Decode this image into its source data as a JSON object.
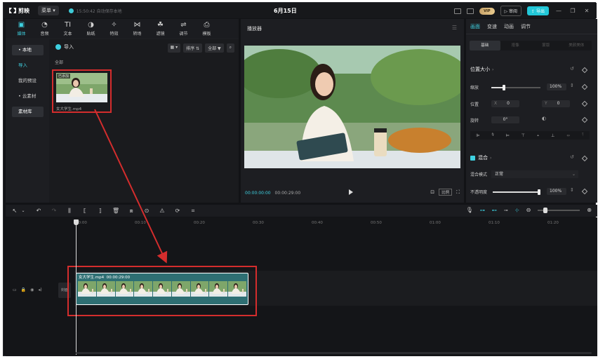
{
  "topbar": {
    "app_name": "剪映",
    "menu_label": "菜单",
    "autosave": "15:50:42 自动保存本地",
    "title": "6月15日",
    "vip_label": "VIP",
    "review_label": "审阅",
    "export_label": "导出"
  },
  "tools": [
    {
      "icon": "media-icon",
      "label": "媒体"
    },
    {
      "icon": "audio-icon",
      "label": "音频"
    },
    {
      "icon": "text-icon",
      "label": "文本"
    },
    {
      "icon": "sticker-icon",
      "label": "贴纸"
    },
    {
      "icon": "effects-icon",
      "label": "特效"
    },
    {
      "icon": "transition-icon",
      "label": "转场"
    },
    {
      "icon": "filter-icon",
      "label": "滤镜"
    },
    {
      "icon": "adjust-icon",
      "label": "调节"
    },
    {
      "icon": "template-icon",
      "label": "模板"
    }
  ],
  "side_nav": {
    "local": "• 本地",
    "import": "导入",
    "my_presets": "我的预设",
    "cloud": "• 云素材",
    "library": "素材库"
  },
  "media": {
    "import_label": "导入",
    "sort_label": "排序",
    "filter_label": "全部",
    "all_label": "全部",
    "added_badge": "已添加",
    "file_name": "女大学生.mp4"
  },
  "player": {
    "title": "播放器",
    "current_time": "00:00:00:00",
    "total_time": "00:00:29:00",
    "ratio_label": "比例"
  },
  "properties": {
    "tabs": [
      "画面",
      "变速",
      "动画",
      "调节"
    ],
    "sub_tabs": [
      "基础",
      "抠像",
      "蒙版",
      "美颜美体"
    ],
    "position_size": "位置大小",
    "scale_label": "缩放",
    "scale_value": "100%",
    "scale_fraction": 0.25,
    "position_label": "位置",
    "pos_x_axis": "X",
    "pos_x": "0",
    "pos_y_axis": "Y",
    "pos_y": "0",
    "rotate_label": "旋转",
    "rotate_value": "0°",
    "blend_label": "混合",
    "blend_mode_label": "混合模式",
    "blend_mode_value": "正常",
    "opacity_label": "不透明度",
    "opacity_value": "100%",
    "opacity_fraction": 1.0
  },
  "timeline": {
    "ruler": [
      "00:00",
      "00:10",
      "00:20",
      "00:30",
      "00:40",
      "00:50",
      "01:00",
      "01:10",
      "01:20"
    ],
    "cover_label": "封面",
    "clip_name": "女大学生.mp4",
    "clip_duration": "00:00:29:00"
  },
  "colors": {
    "accent": "#3ed0e0",
    "highlight": "#d42d2d",
    "clip": "#2e6f73"
  }
}
